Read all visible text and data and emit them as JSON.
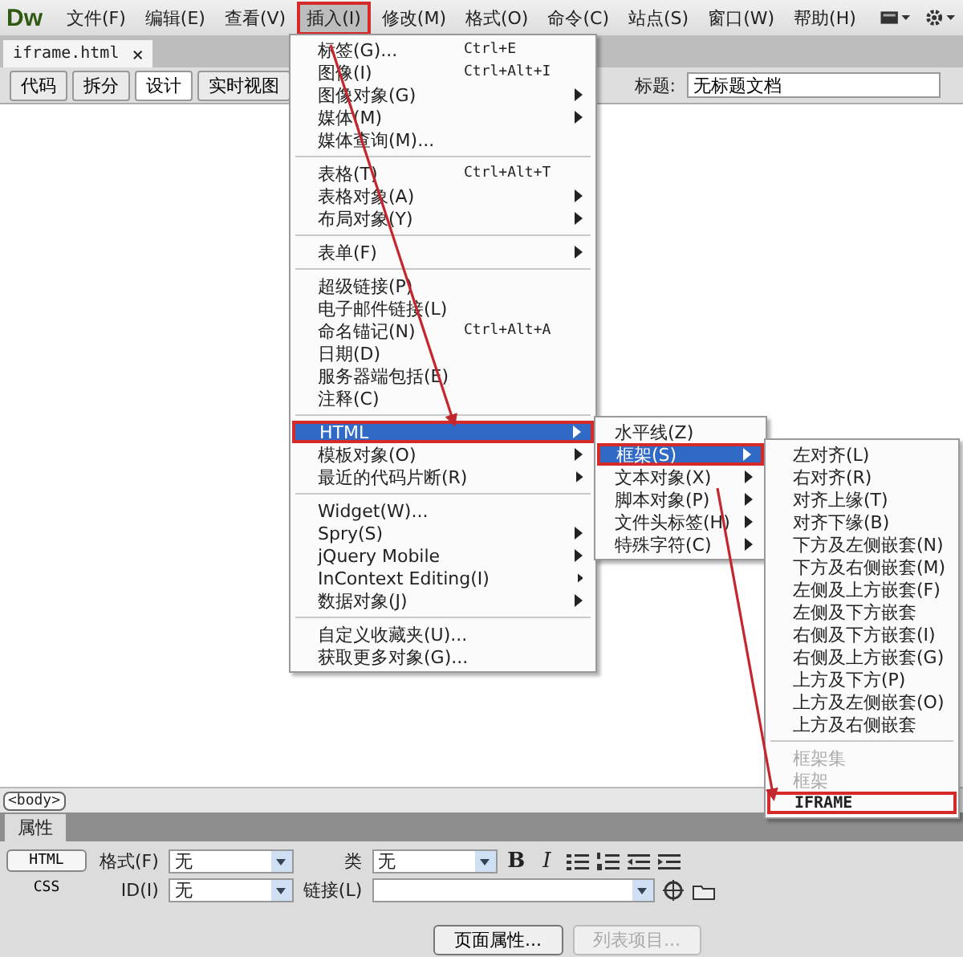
{
  "app": {
    "logo": "Dw"
  },
  "menubar": [
    {
      "label": "文件(F)",
      "selected": false,
      "annotated": false
    },
    {
      "label": "编辑(E)",
      "selected": false,
      "annotated": false
    },
    {
      "label": "查看(V)",
      "selected": false,
      "annotated": false
    },
    {
      "label": "插入(I)",
      "selected": true,
      "annotated": true
    },
    {
      "label": "修改(M)",
      "selected": false,
      "annotated": false
    },
    {
      "label": "格式(O)",
      "selected": false,
      "annotated": false
    },
    {
      "label": "命令(C)",
      "selected": false,
      "annotated": false
    },
    {
      "label": "站点(S)",
      "selected": false,
      "annotated": false
    },
    {
      "label": "窗口(W)",
      "selected": false,
      "annotated": false
    },
    {
      "label": "帮助(H)",
      "selected": false,
      "annotated": false
    }
  ],
  "document_tab": {
    "label": "iframe.html",
    "close": "×"
  },
  "view_buttons": [
    {
      "label": "代码",
      "selected": false
    },
    {
      "label": "拆分",
      "selected": false
    },
    {
      "label": "设计",
      "selected": true
    },
    {
      "label": "实时视图",
      "selected": false
    }
  ],
  "title_field": {
    "label": "标题:",
    "value": "无标题文档"
  },
  "insert_menu": {
    "sections": [
      {
        "items": [
          {
            "label": "标签(G)...",
            "shortcut": "Ctrl+E",
            "arrow": false
          },
          {
            "label": "图像(I)",
            "shortcut": "Ctrl+Alt+I",
            "arrow": false
          },
          {
            "label": "图像对象(G)",
            "arrow": true
          },
          {
            "label": "媒体(M)",
            "arrow": true
          },
          {
            "label": "媒体查询(M)...",
            "arrow": false
          }
        ]
      },
      {
        "items": [
          {
            "label": "表格(T)",
            "shortcut": "Ctrl+Alt+T",
            "arrow": false
          },
          {
            "label": "表格对象(A)",
            "arrow": true
          },
          {
            "label": "布局对象(Y)",
            "arrow": true
          }
        ]
      },
      {
        "items": [
          {
            "label": "表单(F)",
            "arrow": true
          }
        ]
      },
      {
        "items": [
          {
            "label": "超级链接(P)",
            "arrow": false
          },
          {
            "label": "电子邮件链接(L)",
            "arrow": false
          },
          {
            "label": "命名锚记(N)",
            "shortcut": "Ctrl+Alt+A",
            "arrow": false
          },
          {
            "label": "日期(D)",
            "arrow": false
          },
          {
            "label": "服务器端包括(E)",
            "arrow": false
          },
          {
            "label": "注释(C)",
            "arrow": false
          }
        ]
      },
      {
        "items": [
          {
            "label": "HTML",
            "arrow": true,
            "selected": true,
            "annotated": true,
            "children": [
              {
                "items": [
                  {
                    "label": "水平线(Z)",
                    "arrow": false
                  },
                  {
                    "label": "框架(S)",
                    "arrow": true,
                    "selected": true,
                    "annotated": true,
                    "children": [
                      {
                        "items": [
                          {
                            "label": "左对齐(L)"
                          },
                          {
                            "label": "右对齐(R)"
                          },
                          {
                            "label": "对齐上缘(T)"
                          },
                          {
                            "label": "对齐下缘(B)"
                          },
                          {
                            "label": "下方及左侧嵌套(N)"
                          },
                          {
                            "label": "下方及右侧嵌套(M)"
                          },
                          {
                            "label": "左侧及上方嵌套(F)"
                          },
                          {
                            "label": "左侧及下方嵌套"
                          },
                          {
                            "label": "右侧及下方嵌套(I)"
                          },
                          {
                            "label": "右侧及上方嵌套(G)"
                          },
                          {
                            "label": "上方及下方(P)"
                          },
                          {
                            "label": "上方及左侧嵌套(O)"
                          },
                          {
                            "label": "上方及右侧嵌套"
                          }
                        ]
                      },
                      {
                        "items": [
                          {
                            "label": "框架集",
                            "disabled": true
                          },
                          {
                            "label": "框架",
                            "disabled": true
                          },
                          {
                            "label": "IFRAME",
                            "disabled": false,
                            "annotated": true
                          }
                        ]
                      }
                    ]
                  },
                  {
                    "label": "文本对象(X)",
                    "arrow": true
                  },
                  {
                    "label": "脚本对象(P)",
                    "arrow": true
                  },
                  {
                    "label": "文件头标签(H)",
                    "arrow": true
                  },
                  {
                    "label": "特殊字符(C)",
                    "arrow": true
                  }
                ]
              }
            ]
          },
          {
            "label": "模板对象(O)",
            "arrow": true
          },
          {
            "label": "最近的代码片断(R)",
            "arrow": true
          }
        ]
      },
      {
        "items": [
          {
            "label": "Widget(W)...",
            "arrow": false
          },
          {
            "label": "Spry(S)",
            "arrow": true
          },
          {
            "label": "jQuery Mobile",
            "arrow": true
          },
          {
            "label": "InContext Editing(I)",
            "arrow": true
          },
          {
            "label": "数据对象(J)",
            "arrow": true
          }
        ]
      },
      {
        "items": [
          {
            "label": "自定义收藏夹(U)...",
            "arrow": false
          },
          {
            "label": "获取更多对象(G)...",
            "arrow": false
          }
        ]
      }
    ]
  },
  "status_bar": {
    "tag": "<body>"
  },
  "properties": {
    "tab": "属性",
    "modes": [
      {
        "label": "HTML",
        "selected": true
      },
      {
        "label": "CSS",
        "selected": false
      }
    ],
    "format": {
      "label": "格式(F)",
      "value": "无"
    },
    "id": {
      "label": "ID(I)",
      "value": "无"
    },
    "class": {
      "label": "类",
      "value": "无"
    },
    "link": {
      "label": "链接(L)"
    },
    "bold": "B",
    "italic": "I",
    "page_properties": {
      "label": "页面属性...",
      "disabled": false
    },
    "list_item": {
      "label": "列表项目...",
      "disabled": true
    }
  }
}
